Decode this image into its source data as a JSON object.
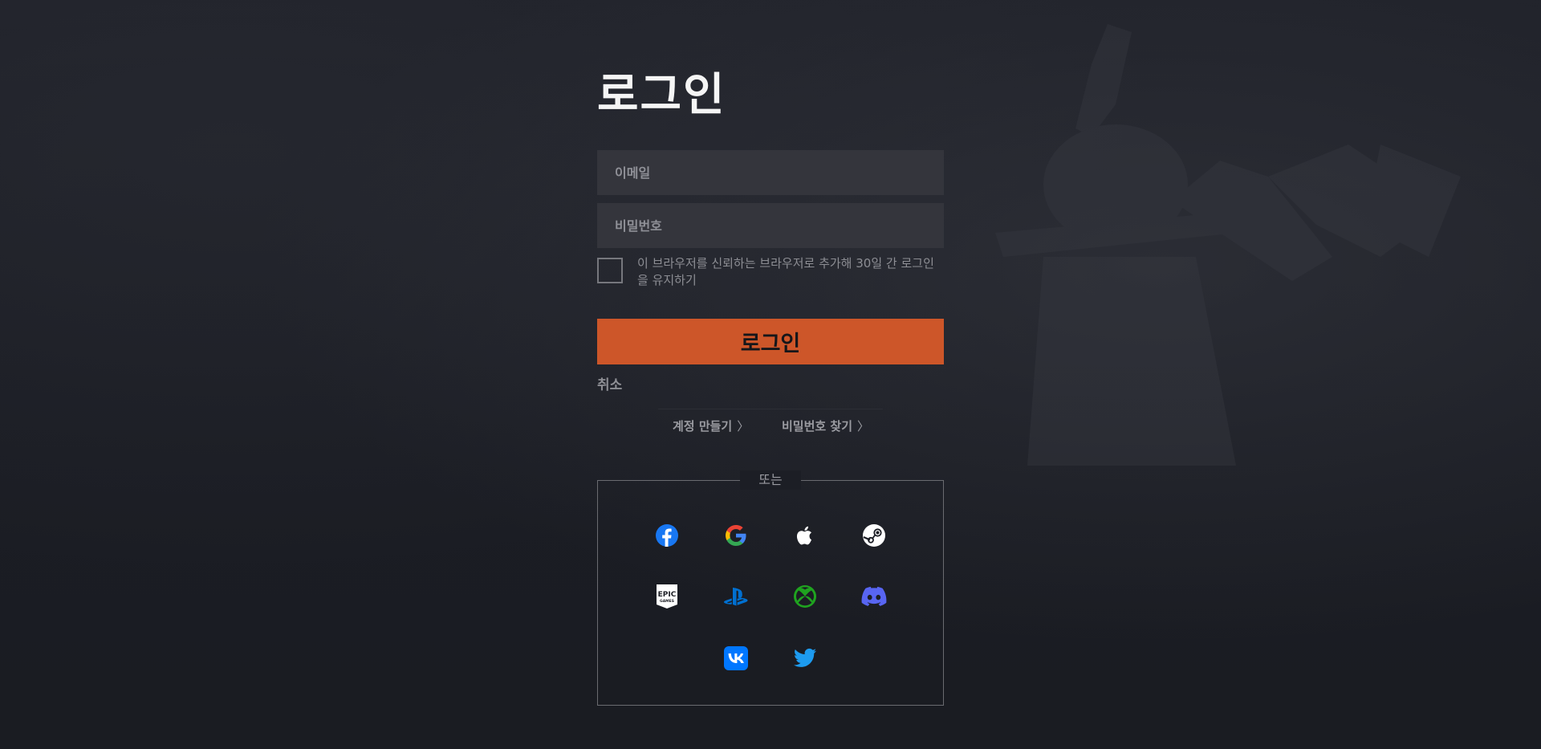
{
  "page": {
    "title": "로그인"
  },
  "form": {
    "email_placeholder": "이메일",
    "password_placeholder": "비밀번호",
    "remember_label": "이 브라우저를 신뢰하는 브라우저로 추가해 30일 간 로그인을 유지하기",
    "remember_checked": false,
    "login_button": "로그인",
    "cancel_label": "취소"
  },
  "links": {
    "create_account": "계정 만들기",
    "find_password": "비밀번호 찾기",
    "chevron": "〉"
  },
  "social": {
    "or_label": "또는",
    "providers": [
      {
        "name": "facebook",
        "icon": "facebook-icon",
        "color": "#1877f2"
      },
      {
        "name": "google",
        "icon": "google-icon",
        "color": "#4285f4"
      },
      {
        "name": "apple",
        "icon": "apple-icon",
        "color": "#ffffff"
      },
      {
        "name": "steam",
        "icon": "steam-icon",
        "color": "#ffffff"
      },
      {
        "name": "epic games",
        "icon": "epic-games-icon",
        "color": "#ffffff"
      },
      {
        "name": "playstation",
        "icon": "playstation-icon",
        "color": "#0070d1"
      },
      {
        "name": "xbox",
        "icon": "xbox-icon",
        "color": "#107c10"
      },
      {
        "name": "discord",
        "icon": "discord-icon",
        "color": "#5865f2"
      },
      {
        "name": "vk",
        "icon": "vk-icon",
        "color": "#0077ff"
      },
      {
        "name": "twitter",
        "icon": "twitter-icon",
        "color": "#1d9bf0"
      }
    ],
    "epic_text": "EPIC",
    "epic_subtext": "GAMES"
  },
  "colors": {
    "accent": "#cd5629",
    "background": "#1b1d24",
    "field_bg": "#34353c"
  }
}
